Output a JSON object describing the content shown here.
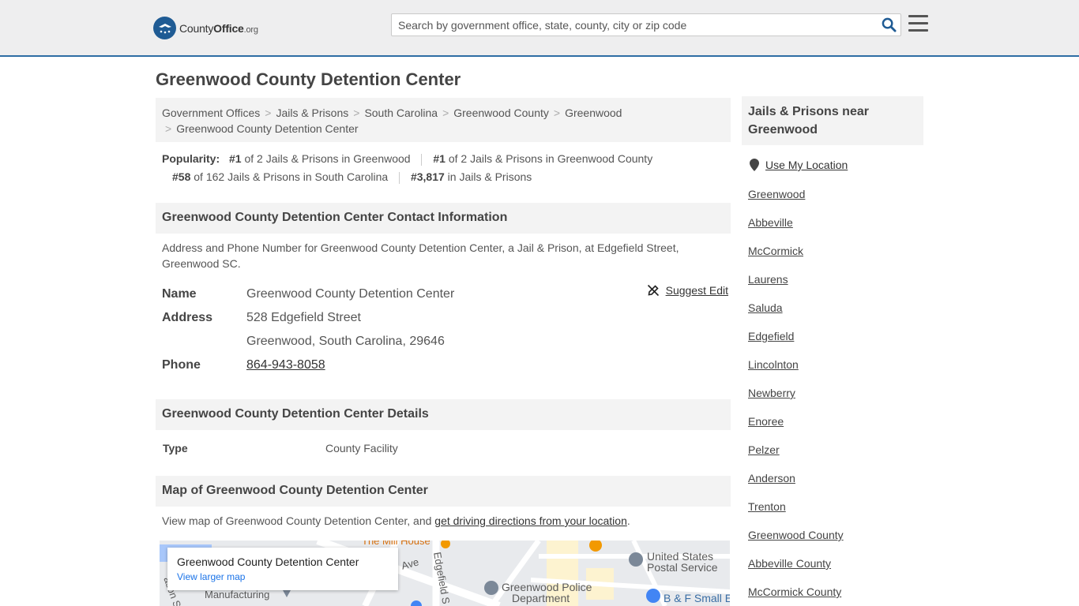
{
  "header": {
    "logo": {
      "brand_bold": "County",
      "brand_mid": "Office",
      "brand_tld": ".org"
    },
    "search": {
      "placeholder": "Search by government office, state, county, city or zip code"
    },
    "icons": {
      "search": "search-icon",
      "menu": "hamburger-menu-icon"
    }
  },
  "page": {
    "title": "Greenwood County Detention Center"
  },
  "breadcrumbs": [
    "Government Offices",
    "Jails & Prisons",
    "South Carolina",
    "Greenwood County",
    "Greenwood",
    "Greenwood County Detention Center"
  ],
  "popularity": {
    "label": "Popularity:",
    "items": [
      {
        "rank": "#1",
        "text": " of 2 Jails & Prisons in Greenwood"
      },
      {
        "rank": "#1",
        "text": " of 2 Jails & Prisons in Greenwood County"
      },
      {
        "rank": "#58",
        "text": " of 162 Jails & Prisons in South Carolina"
      },
      {
        "rank": "#3,817",
        "text": " in Jails & Prisons"
      }
    ]
  },
  "contact": {
    "heading": "Greenwood County Detention Center Contact Information",
    "description": "Address and Phone Number for Greenwood County Detention Center, a Jail & Prison, at Edgefield Street, Greenwood SC.",
    "suggest_edit": "Suggest Edit",
    "name_label": "Name",
    "name_value": "Greenwood County Detention Center",
    "address_label": "Address",
    "address_line1": "528 Edgefield Street",
    "address_line2": "Greenwood, South Carolina, 29646",
    "phone_label": "Phone",
    "phone_value": "864-943-8058"
  },
  "details": {
    "heading": "Greenwood County Detention Center Details",
    "type_label": "Type",
    "type_value": "County Facility"
  },
  "map_section": {
    "heading": "Map of Greenwood County Detention Center",
    "desc_prefix": "View map of Greenwood County Detention Center, and ",
    "desc_link": "get driving directions from your location",
    "desc_suffix": ".",
    "card_title": "Greenwood County Detention Center",
    "card_link": "View larger map",
    "labels": {
      "mill_house": "The Mill House",
      "ave": "Ave",
      "edgefield": "Edgefield S",
      "usps_1": "United States",
      "usps_2": "Postal Service",
      "police_1": "Greenwood Police",
      "police_2": "Department",
      "bf": "B & F Small E",
      "manufacturing": "Manufacturing",
      "mason": "ason S"
    }
  },
  "sidebar": {
    "heading": "Jails & Prisons near Greenwood",
    "use_location": "Use My Location",
    "items": [
      "Greenwood",
      "Abbeville",
      "McCormick",
      "Laurens",
      "Saluda",
      "Edgefield",
      "Lincolnton",
      "Newberry",
      "Enoree",
      "Pelzer",
      "Anderson",
      "Trenton",
      "Greenwood County",
      "Abbeville County",
      "McCormick County"
    ]
  }
}
